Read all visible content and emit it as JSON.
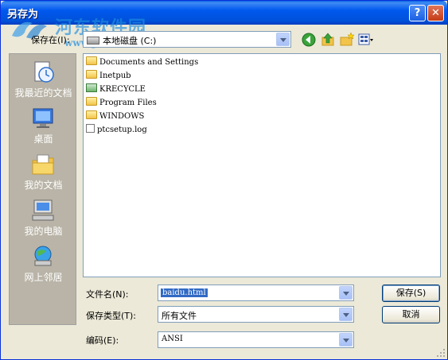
{
  "window": {
    "title": "另存为",
    "help_label": "?",
    "close_label": "✕"
  },
  "watermark": {
    "text": "河东软件园",
    "url": "www.pc0359.cn"
  },
  "lookin": {
    "label": "保存在(I):",
    "value": "本地磁盘 (C:)"
  },
  "toolbar": {
    "icons": [
      "back-icon",
      "up-folder-icon",
      "new-folder-icon",
      "views-menu-icon"
    ]
  },
  "places": [
    {
      "label": "我最近的文档",
      "icon": "recent-documents-icon"
    },
    {
      "label": "桌面",
      "icon": "desktop-icon"
    },
    {
      "label": "我的文档",
      "icon": "my-documents-icon"
    },
    {
      "label": "我的电脑",
      "icon": "my-computer-icon"
    },
    {
      "label": "网上邻居",
      "icon": "network-places-icon"
    }
  ],
  "files": [
    {
      "name": "Documents and Settings",
      "icon": "folder-icon"
    },
    {
      "name": "Inetpub",
      "icon": "folder-icon"
    },
    {
      "name": "KRECYCLE",
      "icon": "recycle-folder-icon"
    },
    {
      "name": "Program Files",
      "icon": "folder-icon"
    },
    {
      "name": "WINDOWS",
      "icon": "folder-icon"
    },
    {
      "name": "ptcsetup.log",
      "icon": "text-file-icon"
    }
  ],
  "form": {
    "filename_label": "文件名(N):",
    "filename_value": "baidu.html",
    "filetype_label": "保存类型(T):",
    "filetype_value": "所有文件",
    "encoding_label": "编码(E):",
    "encoding_value": "ANSI"
  },
  "buttons": {
    "save": "保存(S)",
    "cancel": "取消"
  },
  "colors": {
    "titlebar": "#0058ee",
    "selection": "#316ac5",
    "places_bg": "#b9b4a7"
  }
}
